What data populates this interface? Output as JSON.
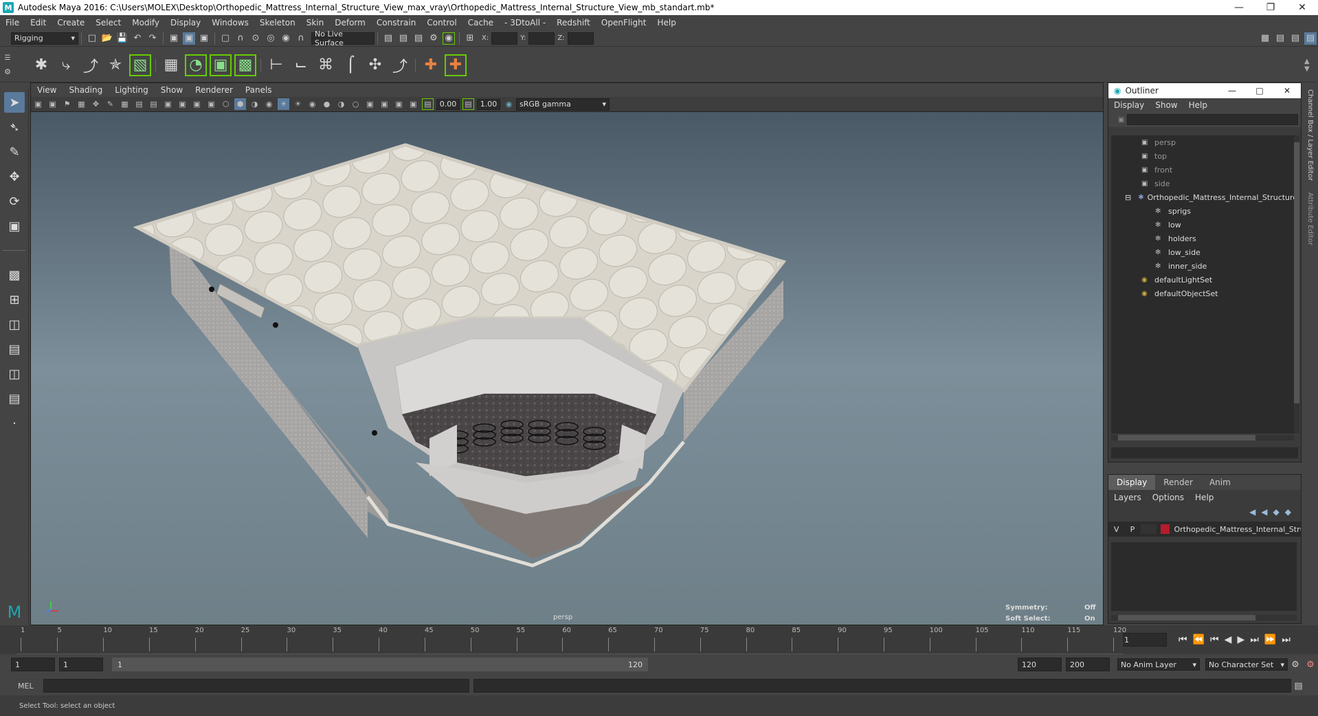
{
  "titlebar": {
    "title": "Autodesk Maya 2016: C:\\Users\\MOLEX\\Desktop\\Orthopedic_Mattress_Internal_Structure_View_max_vray\\Orthopedic_Mattress_Internal_Structure_View_mb_standart.mb*"
  },
  "menubar": [
    "File",
    "Edit",
    "Create",
    "Select",
    "Modify",
    "Display",
    "Windows",
    "Skeleton",
    "Skin",
    "Deform",
    "Constrain",
    "Control",
    "Cache",
    "- 3DtoAll -",
    "Redshift",
    "OpenFlight",
    "Help"
  ],
  "statusline": {
    "mode": "Rigging",
    "live_surface": "No Live Surface",
    "x_label": "X:",
    "y_label": "Y:",
    "z_label": "Z:"
  },
  "viewport": {
    "menu": [
      "View",
      "Shading",
      "Lighting",
      "Show",
      "Renderer",
      "Panels"
    ],
    "exposure": "0.00",
    "gamma": "1.00",
    "colorspace": "sRGB gamma",
    "camera_label": "persp",
    "symmetry_label": "Symmetry:",
    "symmetry_value": "Off",
    "softselect_label": "Soft Select:",
    "softselect_value": "On"
  },
  "outliner": {
    "title": "Outliner",
    "menu": [
      "Display",
      "Show",
      "Help"
    ],
    "items": [
      {
        "label": "persp",
        "type": "camera"
      },
      {
        "label": "top",
        "type": "camera"
      },
      {
        "label": "front",
        "type": "camera"
      },
      {
        "label": "side",
        "type": "camera"
      },
      {
        "label": "Orthopedic_Mattress_Internal_Structure",
        "type": "group"
      },
      {
        "label": "sprigs",
        "type": "mesh"
      },
      {
        "label": "low",
        "type": "mesh"
      },
      {
        "label": "holders",
        "type": "mesh"
      },
      {
        "label": "low_side",
        "type": "mesh"
      },
      {
        "label": "inner_side",
        "type": "mesh"
      },
      {
        "label": "defaultLightSet",
        "type": "set"
      },
      {
        "label": "defaultObjectSet",
        "type": "set"
      }
    ]
  },
  "layers": {
    "tabs": [
      "Display",
      "Render",
      "Anim"
    ],
    "menu": [
      "Layers",
      "Options",
      "Help"
    ],
    "row": {
      "v": "V",
      "p": "P",
      "name": "Orthopedic_Mattress_Internal_Stru"
    }
  },
  "sidetabs": {
    "channel": "Channel Box / Layer Editor",
    "attribute": "Attribute Editor"
  },
  "timeline": {
    "ticks": [
      "1",
      "5",
      "10",
      "15",
      "20",
      "25",
      "30",
      "35",
      "40",
      "45",
      "50",
      "55",
      "60",
      "65",
      "70",
      "75",
      "80",
      "85",
      "90",
      "95",
      "100",
      "105",
      "110",
      "115",
      "120"
    ],
    "current_frame": "1"
  },
  "range": {
    "start": "1",
    "inner_start": "1",
    "slider_start": "1",
    "slider_end": "120",
    "end": "120",
    "max_end": "200",
    "anim_layer": "No Anim Layer",
    "char_set": "No Character Set"
  },
  "cmdline": {
    "label": "MEL"
  },
  "helpline": {
    "text": "Select Tool: select an object"
  },
  "colors": {
    "accent": "#5a7a9c",
    "layer_color": "#b51c2c",
    "maya_logo": "#1aa7b4"
  }
}
